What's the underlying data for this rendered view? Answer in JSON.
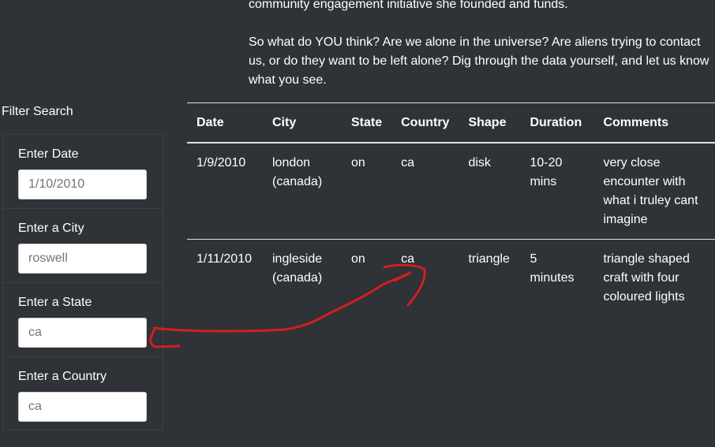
{
  "intro": {
    "line1": "community engagement initiative she founded and funds.",
    "paragraph2": "So what do YOU think? Are we alone in the universe? Are aliens trying to contact us, or do they want to be left alone? Dig through the data yourself, and let us know what you see."
  },
  "filters": {
    "title": "Filter Search",
    "date": {
      "label": "Enter Date",
      "placeholder": "1/10/2010"
    },
    "city": {
      "label": "Enter a City",
      "placeholder": "roswell"
    },
    "state": {
      "label": "Enter a State",
      "value": "ca"
    },
    "country": {
      "label": "Enter a Country",
      "value": "ca"
    }
  },
  "table": {
    "headers": [
      "Date",
      "City",
      "State",
      "Country",
      "Shape",
      "Duration",
      "Comments"
    ],
    "rows": [
      [
        "1/9/2010",
        "london (canada)",
        "on",
        "ca",
        "disk",
        "10-20 mins",
        "very close encounter with what i truley cant imagine"
      ],
      [
        "1/11/2010",
        "ingleside (canada)",
        "on",
        "ca",
        "triangle",
        "5 minutes",
        "triangle shaped craft with four coloured lights"
      ]
    ]
  },
  "annotation": {
    "color": "#d11f1f"
  },
  "colors": {
    "background": "#2f3237",
    "text": "#ffffff",
    "input_bg": "#ffffff",
    "input_text": "#6c757d",
    "rule": "#dee2e6"
  }
}
